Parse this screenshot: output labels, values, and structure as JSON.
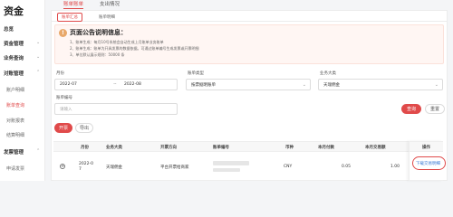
{
  "sidebar": {
    "brand": "资金",
    "items": [
      {
        "label": "总览"
      },
      {
        "label": "资金管理"
      },
      {
        "label": "业务查询"
      },
      {
        "label": "对账管理"
      },
      {
        "label": "发票管理"
      }
    ],
    "subitems": [
      {
        "label": "账户明细"
      },
      {
        "label": "账单查询"
      },
      {
        "label": "对账报表"
      },
      {
        "label": "结算明细"
      },
      {
        "label": "申请发票"
      }
    ]
  },
  "top_tabs": [
    "账单账单",
    "支出情况"
  ],
  "sub_tabs": [
    "账单汇总",
    "账单明细"
  ],
  "notice": {
    "title": "页面公告说明信息：",
    "lines": [
      "1、账单生成：每月10号系统会自动生成上月账单业务账单",
      "2、账单生成：账单为开具发票的数据依据。可通过账单编号生成发票或开票明细",
      "3、单位默认展示规则：50000 条"
    ]
  },
  "filters": {
    "month_label": "月份",
    "month_start": "2022-07",
    "month_end": "2022-08",
    "type_label": "账单类型",
    "type_value": "按票据明账单",
    "biz_label": "业务大类",
    "biz_value": "天瑞佣金",
    "no_label": "账单编号",
    "no_placeholder": "请输入"
  },
  "buttons": {
    "query": "查询",
    "reset": "重置",
    "invoice": "开票",
    "export": "导出"
  },
  "table": {
    "headers": [
      "月份",
      "业务大类",
      "开票方向",
      "账单编号",
      "币种",
      "本月付款",
      "本月交易额",
      "操作"
    ],
    "row": {
      "month": "2022-07",
      "biz": "天瑞佣金",
      "direction": "平台开票给商家",
      "currency": "CNY",
      "payment": "0.05",
      "amount": "1.00",
      "action": "下载交易明细"
    }
  },
  "colors": {
    "accent": "#e04a4a",
    "link": "#3a7bd5",
    "notice_bg": "#fff6f3"
  }
}
